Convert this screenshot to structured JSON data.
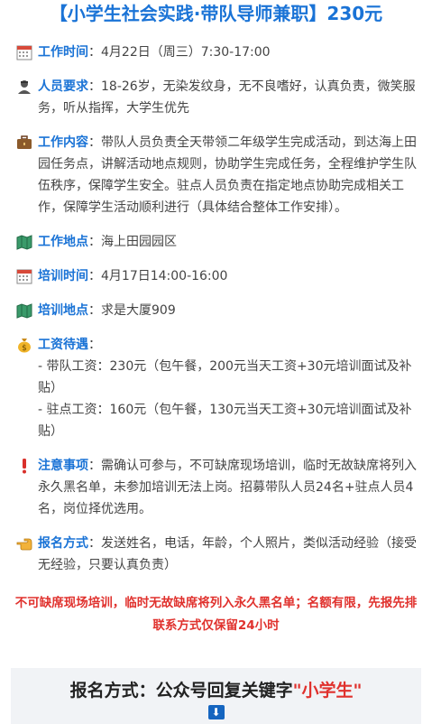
{
  "title": "【小学生社会实践·带队导师兼职】230元",
  "items": [
    {
      "icon": "calendar-icon",
      "label": "工作时间",
      "text": "：4月22日（周三）7:30-17:00"
    },
    {
      "icon": "person-icon",
      "label": "人员要求",
      "text": "：18-26岁，无染发纹身，无不良嗜好，认真负责，微笑服务，听从指挥，大学生优先"
    },
    {
      "icon": "briefcase-icon",
      "label": "工作内容",
      "text": "：带队人员负责全天带领二年级学生完成活动，到达海上田园任务点，讲解活动地点规则，协助学生完成任务，全程维护学生队伍秩序，保障学生安全。驻点人员负责在指定地点协助完成相关工作，保障学生活动顺利进行（具体结合整体工作安排）。"
    },
    {
      "icon": "map-icon",
      "label": "工作地点",
      "text": "：海上田园园区"
    },
    {
      "icon": "calendar-icon",
      "label": "培训时间",
      "text": "：4月17日14:00-16:00"
    },
    {
      "icon": "map-icon",
      "label": "培训地点",
      "text": "：求是大厦909"
    },
    {
      "icon": "money-bag-icon",
      "label": "工资待遇",
      "text": "：",
      "lines": [
        "- 带队工资：230元（包午餐，200元当天工资+30元培训面试及补贴）",
        "- 驻点工资：160元（包午餐，130元当天工资+30元培训面试及补贴）"
      ]
    },
    {
      "icon": "exclamation-icon",
      "label": "注意事项",
      "text": "：需确认可参与，不可缺席现场培训，临时无故缺席将列入永久黑名单，未参加培训无法上岗。招募带队人员24名+驻点人员4名，岗位择优选用。"
    },
    {
      "icon": "pointing-hand-icon",
      "label": "报名方式",
      "text": "：发送姓名，电话，年龄，个人照片，类似活动经验（接受无经验，只要认真负责）"
    }
  ],
  "warning_line1": "不可缺席现场培训，临时无故缺席将列入永久黑名单；名额有限，先报先排",
  "warning_line2": "联系方式仅保留24小时",
  "footer": {
    "prefix": "报名方式：公众号回复关键字",
    "keyword": "\"小学生\"",
    "arrow": "⬇"
  }
}
